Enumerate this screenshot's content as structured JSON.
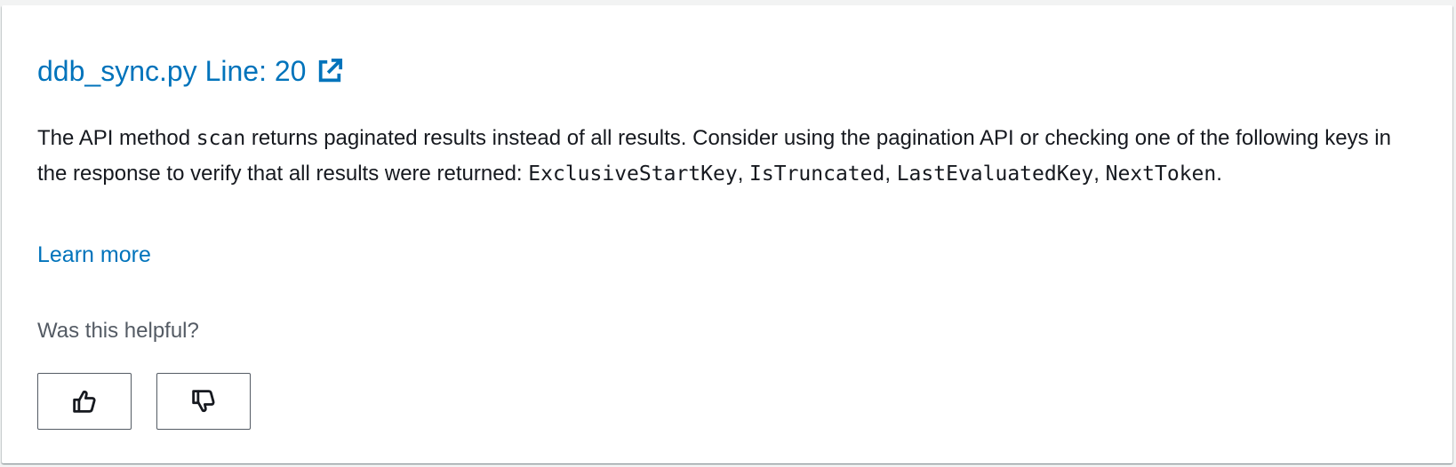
{
  "finding": {
    "title": "ddb_sync.py Line: 20",
    "title_icon": "external-link-icon",
    "description_segments": [
      {
        "text": "The API method ",
        "code": false
      },
      {
        "text": "scan",
        "code": true
      },
      {
        "text": " returns paginated results instead of all results. Consider using the pagination API or checking one of the following keys in the response to verify that all results were returned: ",
        "code": false
      },
      {
        "text": "ExclusiveStartKey",
        "code": true
      },
      {
        "text": ", ",
        "code": false
      },
      {
        "text": "IsTruncated",
        "code": true
      },
      {
        "text": ", ",
        "code": false
      },
      {
        "text": "LastEvaluatedKey",
        "code": true
      },
      {
        "text": ", ",
        "code": false
      },
      {
        "text": "NextToken",
        "code": true
      },
      {
        "text": ".",
        "code": false
      }
    ],
    "learn_more_label": "Learn more"
  },
  "feedback": {
    "question": "Was this helpful?",
    "thumbs_up_icon": "thumbs-up-icon",
    "thumbs_down_icon": "thumbs-down-icon"
  },
  "colors": {
    "link": "#0073bb",
    "text": "#16191f",
    "muted_text": "#545b64",
    "card_background": "#ffffff",
    "page_background": "#f2f3f3"
  }
}
